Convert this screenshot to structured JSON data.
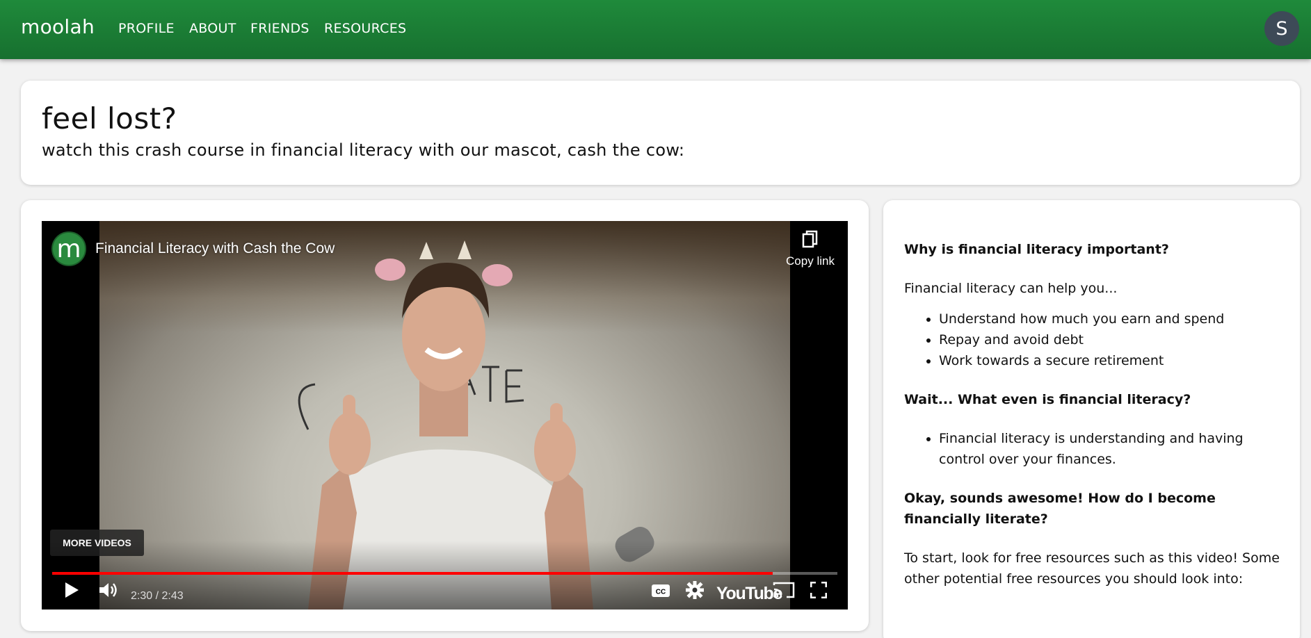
{
  "navbar": {
    "brand": "moolah",
    "links": [
      "PROFILE",
      "ABOUT",
      "FRIENDS",
      "RESOURCES"
    ],
    "avatar_initial": "S"
  },
  "hero": {
    "title": "feel lost?",
    "subtitle": "watch this crash course in financial literacy with our mascot, cash the cow:"
  },
  "video": {
    "channel_logo_letter": "m",
    "title": "Financial Literacy with Cash the Cow",
    "copy_link_label": "Copy link",
    "more_videos_label": "MORE VIDEOS",
    "time": "2:30 / 2:43",
    "progress_fraction": 0.918,
    "youtube_label": "YouTube",
    "accent_color": "#ff0000",
    "icons": [
      "play-icon",
      "volume-icon",
      "cc-icon",
      "settings-icon",
      "cast-icon",
      "fullscreen-icon",
      "copy-icon"
    ]
  },
  "faq": {
    "q1": "Why is financial literacy important?",
    "p1": "Financial literacy can help you...",
    "list1": [
      "Understand how much you earn and spend",
      "Repay and avoid debt",
      "Work towards a secure retirement"
    ],
    "q2": "Wait... What even is financial literacy?",
    "list2": [
      "Financial literacy is understanding and having control over your finances."
    ],
    "q3": "Okay, sounds awesome! How do I become financially literate?",
    "p3": "To start, look for free resources such as this video! Some other potential free resources you should look into:"
  },
  "colors": {
    "nav_green": "#1f8a3b",
    "avatar_bg": "#3d4a57",
    "page_bg": "#f2f2f2"
  }
}
